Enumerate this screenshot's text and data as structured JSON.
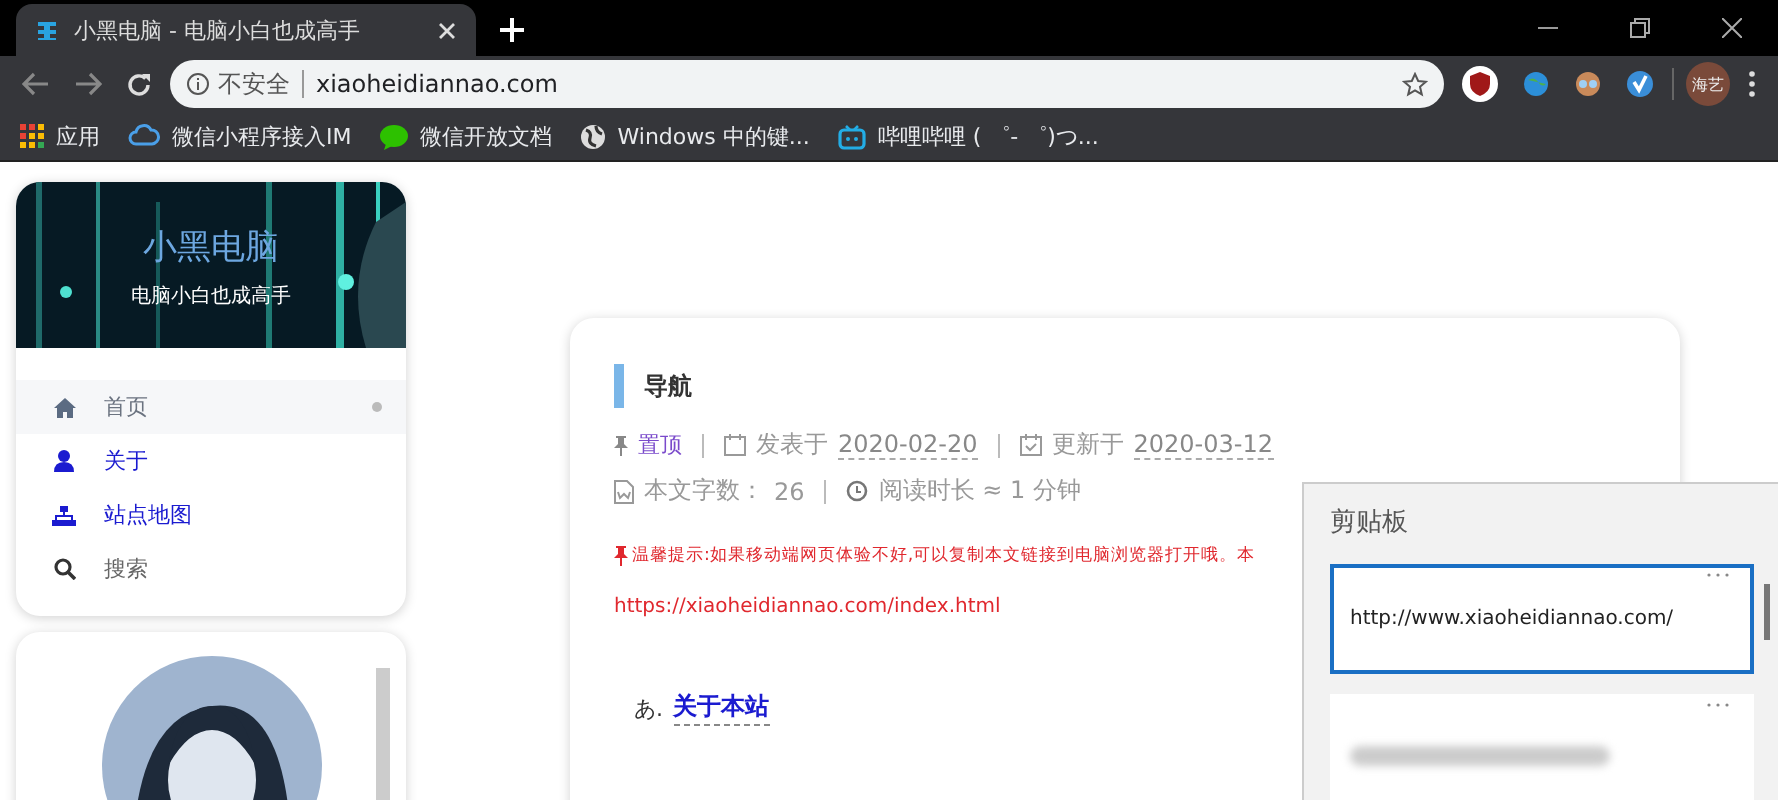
{
  "browser": {
    "tab": {
      "title": "小黑电脑 - 电脑小白也成高手",
      "selected": true
    },
    "address": {
      "security": "不安全",
      "url": "xiaoheidiannao.com"
    },
    "profile": {
      "label": "海艺"
    },
    "bookmarks": [
      {
        "label": "应用",
        "kind": "apps"
      },
      {
        "label": "微信小程序接入IM",
        "kind": "cloud"
      },
      {
        "label": "微信开放文档",
        "kind": "chat"
      },
      {
        "label": "Windows 中的键...",
        "kind": "globe"
      },
      {
        "label": "哔哩哔哩 ( ゜- ゜)つ...",
        "kind": "tv"
      }
    ]
  },
  "site": {
    "title": "小黑电脑",
    "subtitle": "电脑小白也成高手"
  },
  "nav": [
    {
      "label": "首页",
      "kind": "home",
      "selected": true
    },
    {
      "label": "关于",
      "kind": "user",
      "selected": false
    },
    {
      "label": "站点地图",
      "kind": "sitemap",
      "selected": false
    },
    {
      "label": "搜索",
      "kind": "search",
      "selected": false
    }
  ],
  "post": {
    "title": "导航",
    "pinned": "置顶",
    "published_label": "发表于",
    "published": "2020-02-20",
    "updated_label": "更新于",
    "updated": "2020-03-12",
    "words_label": "本文字数：",
    "words": "26",
    "reading": "阅读时长 ≈ 1 分钟",
    "notice": "温馨提示:如果移动端网页体验不好,可以复制本文链接到电脑浏览器打开哦。本",
    "notice_url": "https://xiaoheidiannao.com/index.html",
    "section_prefix": "あ.",
    "section_link": "关于本站"
  },
  "clipboard": {
    "title": "剪贴板",
    "items": [
      {
        "kind": "text",
        "text": "http://www.xiaoheidiannao.com/",
        "selected": true
      },
      {
        "kind": "hidden",
        "selected": false
      }
    ]
  }
}
